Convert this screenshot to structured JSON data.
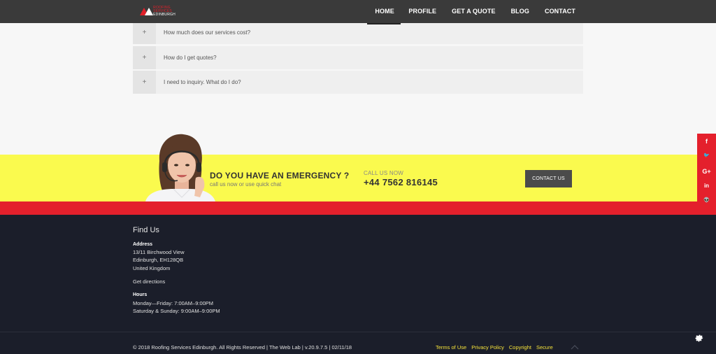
{
  "header": {
    "logo_text_1": "ROOFING SERVICES",
    "logo_text_2": "EDINBURGH",
    "nav": [
      "HOME",
      "PROFILE",
      "GET A QUOTE",
      "BLOG",
      "CONTACT"
    ],
    "active": "HOME"
  },
  "faq": {
    "items": [
      {
        "icon": "+",
        "question": "How much does our services cost?"
      },
      {
        "icon": "+",
        "question": "How do I get quotes?"
      },
      {
        "icon": "+",
        "question": "I need to inquiry. What do I do?"
      }
    ]
  },
  "emergency": {
    "title": "DO YOU HAVE AN EMERGENCY ?",
    "subtitle": "call us now or use quick chat",
    "call_label": "CALL US NOW",
    "phone": "+44 7562 816145",
    "contact_button": "CONTACT US"
  },
  "social": {
    "items": [
      {
        "icon": "facebook-icon",
        "glyph": "f"
      },
      {
        "icon": "twitter-icon",
        "glyph": "🐦"
      },
      {
        "icon": "google-plus-icon",
        "glyph": "G+"
      },
      {
        "icon": "linkedin-icon",
        "glyph": "in"
      },
      {
        "icon": "reddit-icon",
        "glyph": "👽"
      }
    ]
  },
  "footer": {
    "title": "Find Us",
    "address_label": "Address",
    "address_lines": [
      "13/11 Birchwood View",
      "Edinburgh, EH128QB",
      "United Kingdom"
    ],
    "directions": "Get directions",
    "hours_label": "Hours",
    "hours_lines": [
      "Monday—Friday: 7:00AM–9:00PM",
      "Saturday & Sunday: 9:00AM–9:00PM"
    ],
    "copyright": "© 2018 Roofing Services Edinburgh. All Rights Reserved | The Web Lab | v.20.9.7.5 | 02/11/18",
    "links": [
      "Terms of Use",
      "Privacy Policy",
      "Copyright",
      "Secure"
    ]
  },
  "colors": {
    "header": "#3a3a3a",
    "accent_red": "#e4202c",
    "emergency_yellow": "#fafa4e",
    "footer": "#1b1e2a",
    "footer_link": "#f5e23a"
  }
}
